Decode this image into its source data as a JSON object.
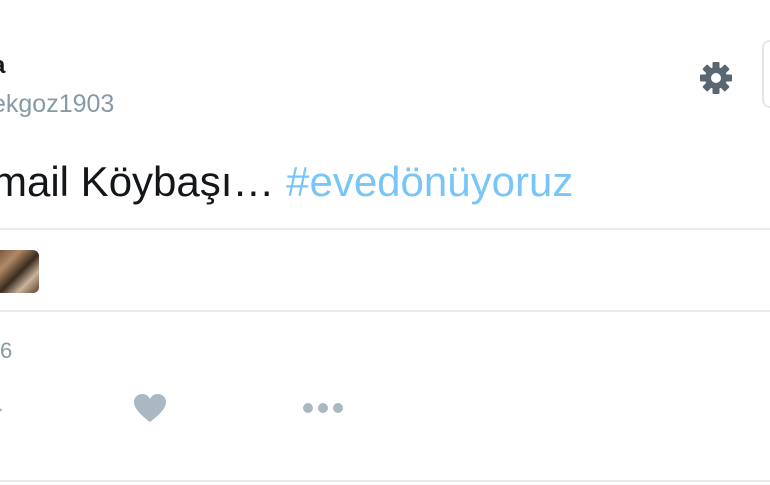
{
  "author": {
    "name_fragment": "a",
    "handle_fragment": "ekgoz1903"
  },
  "tweet": {
    "text": "mail Köybaşı… ",
    "hashtag": "#evedönüyoruz"
  },
  "meta": {
    "date_fragment": "6"
  },
  "icons": {
    "settings": "gear-icon",
    "like": "heart-icon",
    "more": "more-dots-icon",
    "reply": "reply-icon"
  },
  "colors": {
    "hashtag": "#1da1f2",
    "muted": "#8899a6",
    "text": "#14171a",
    "divider": "#e6ecf0"
  }
}
